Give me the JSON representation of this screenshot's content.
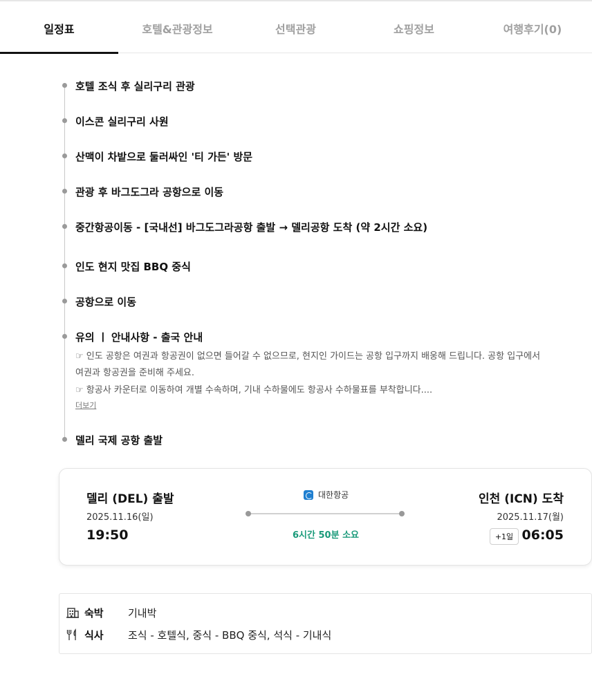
{
  "tabs": [
    {
      "label": "일정표",
      "active": true
    },
    {
      "label": "호텔&관광정보",
      "active": false
    },
    {
      "label": "선택관광",
      "active": false
    },
    {
      "label": "쇼핑정보",
      "active": false
    },
    {
      "label": "여행후기(0)",
      "active": false
    }
  ],
  "timeline": {
    "items": [
      "호텔 조식 후 실리구리 관광",
      "이스콘 실리구리 사원",
      "산맥이 차밭으로 둘러싸인 '티 가든' 방문",
      "관광 후 바그도그라 공항으로 이동",
      "중간항공이동 - [국내선] 바그도그라공항 출발 → 델리공항 도착 (약 2시간 소요)",
      "인도 현지 맛집 BBQ 중식",
      "공항으로 이동",
      "유의 ㅣ 안내사항 - 출국 안내",
      "델리 국제 공항 출발"
    ],
    "notice_lines": [
      "☞ 인도 공항은 여권과 항공권이 없으면 들어갈 수 없으므로, 현지인 가이드는 공항 입구까지 배웅해 드립니다. 공항 입구에서",
      "여권과 항공권을 준비해 주세요.",
      "☞ 항공사 카운터로 이동하여 개별 수속하며, 기내 수하물에도 항공사 수하물표를 부착합니다...."
    ],
    "more_label": "더보기"
  },
  "flight": {
    "departure": {
      "title": "델리 (DEL) 출발",
      "date": "2025.11.16(일)",
      "time": "19:50"
    },
    "arrival": {
      "title": "인천 (ICN) 도착",
      "date": "2025.11.17(월)",
      "time": "06:05",
      "day_offset": "+1일"
    },
    "airline": "대한항공",
    "duration": "6시간 50분 소요"
  },
  "info": {
    "lodging_label": "숙박",
    "lodging_value": "기내박",
    "meal_label": "식사",
    "meal_value": "조식 - 호텔식, 중식 - BBQ 중식, 석식 - 기내식"
  },
  "colors": {
    "accent_green": "#1a9a7a",
    "airline_blue": "#1f7fd0",
    "inactive_tab": "#a0a0a0"
  }
}
